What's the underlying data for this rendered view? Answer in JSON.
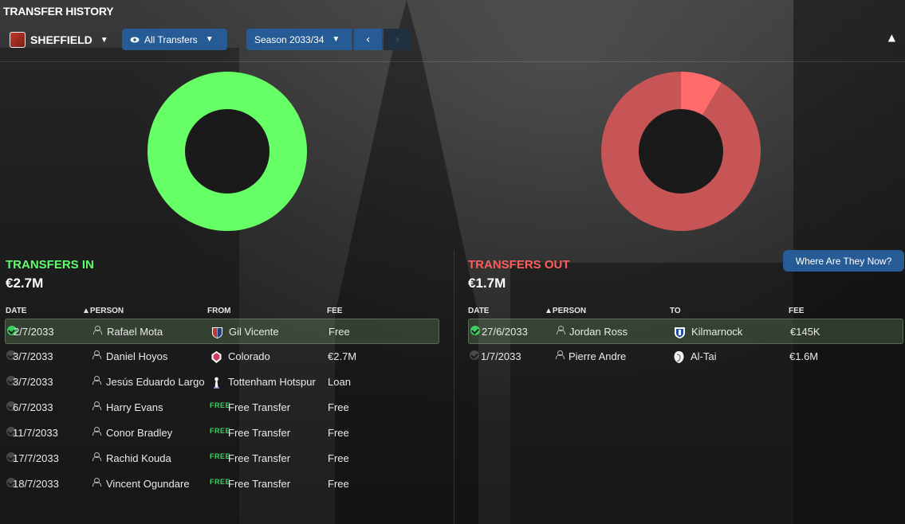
{
  "header": {
    "title": "TRANSFER HISTORY",
    "club": "SHEFFIELD",
    "filter_label": "All Transfers",
    "season_label": "Season 2033/34",
    "prev_icon": "chevron-left-icon",
    "next_icon": "chevron-right-icon",
    "collapse_icon": "chevron-up-icon"
  },
  "colors": {
    "in_accent": "#5dff6a",
    "out_accent": "#ff5c5c",
    "button_blue": "#275b96",
    "donut_in": "#66ff66",
    "donut_out_main": "#c85555",
    "donut_out_slice": "#ff6b6b",
    "donut_hole": "#1a1a1a"
  },
  "transfers_in": {
    "title": "TRANSFERS IN",
    "total": "€2.7M",
    "donut_slices": [
      1.0
    ],
    "columns": {
      "date": "DATE",
      "person": "PERSON",
      "from": "FROM",
      "fee": "FEE"
    },
    "rows": [
      {
        "date": "2/7/2033",
        "person": "Rafael Mota",
        "club": "Gil Vicente",
        "fee": "Free",
        "badge": "gil-vicente-crest-icon",
        "selected": true
      },
      {
        "date": "3/7/2033",
        "person": "Daniel Hoyos",
        "club": "Colorado",
        "fee": "€2.7M",
        "badge": "colorado-crest-icon",
        "selected": false
      },
      {
        "date": "3/7/2033",
        "person": "Jesús Eduardo Largo",
        "club": "Tottenham Hotspur",
        "fee": "Loan",
        "badge": "tottenham-crest-icon",
        "selected": false
      },
      {
        "date": "6/7/2033",
        "person": "Harry Evans",
        "club": "Free Transfer",
        "fee": "Free",
        "free_tag": "FREE",
        "selected": false
      },
      {
        "date": "11/7/2033",
        "person": "Conor Bradley",
        "club": "Free Transfer",
        "fee": "Free",
        "free_tag": "FREE",
        "selected": false
      },
      {
        "date": "17/7/2033",
        "person": "Rachid Kouda",
        "club": "Free Transfer",
        "fee": "Free",
        "free_tag": "FREE",
        "selected": false
      },
      {
        "date": "18/7/2033",
        "person": "Vincent Ogundare",
        "club": "Free Transfer",
        "fee": "Free",
        "free_tag": "FREE",
        "selected": false
      }
    ]
  },
  "transfers_out": {
    "title": "TRANSFERS OUT",
    "total": "€1.7M",
    "donut_slices": [
      0.085,
      0.915
    ],
    "where_button": "Where Are They Now?",
    "columns": {
      "date": "DATE",
      "person": "PERSON",
      "to": "TO",
      "fee": "FEE"
    },
    "rows": [
      {
        "date": "27/6/2033",
        "person": "Jordan Ross",
        "club": "Kilmarnock",
        "fee": "€145K",
        "badge": "kilmarnock-crest-icon",
        "selected": true
      },
      {
        "date": "1/7/2033",
        "person": "Pierre Andre",
        "club": "Al-Tai",
        "fee": "€1.6M",
        "badge": "al-tai-crest-icon",
        "selected": false
      }
    ]
  }
}
